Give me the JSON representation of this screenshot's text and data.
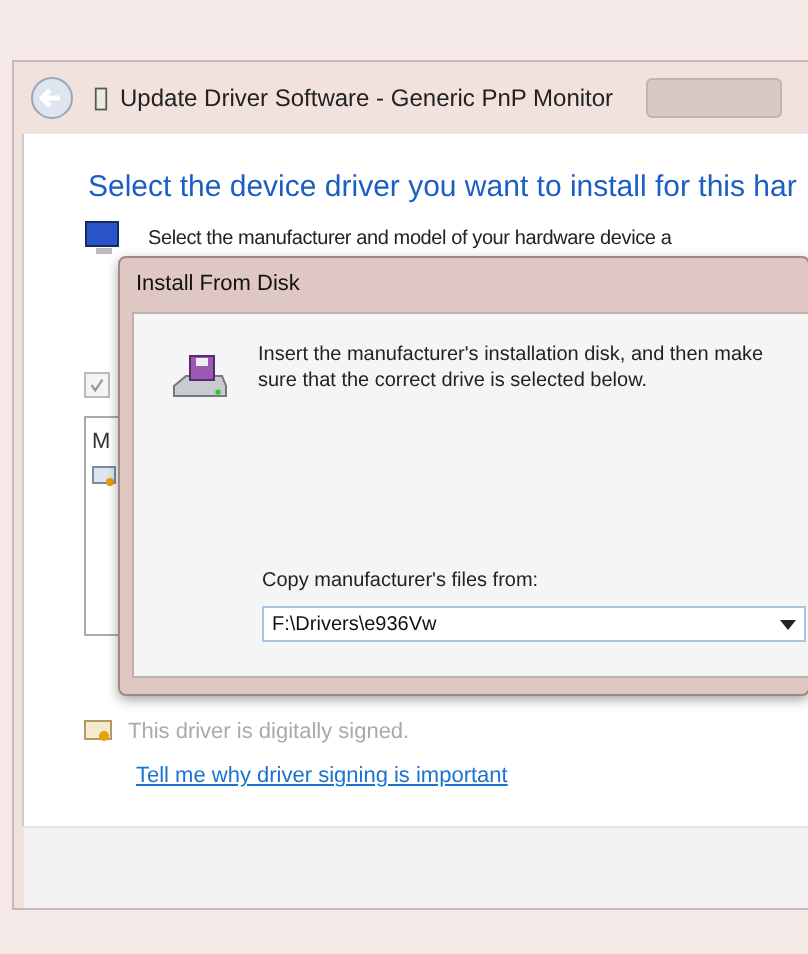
{
  "window": {
    "title": "Update Driver Software - Generic PnP Monitor",
    "heading": "Select the device driver you want to install for this har",
    "instruction": "Select the manufacturer and model of your hardware device a",
    "show_compatible": {
      "checked": true
    },
    "list_header": "M",
    "signed_note": "This driver is digitally signed.",
    "link": "Tell me why driver signing is important"
  },
  "dialog": {
    "title": "Install From Disk",
    "message": "Insert the manufacturer's installation disk, and then make sure that the correct drive is selected below.",
    "copy_label": "Copy manufacturer's files from:",
    "path_value": "F:\\Drivers\\e936Vw"
  }
}
